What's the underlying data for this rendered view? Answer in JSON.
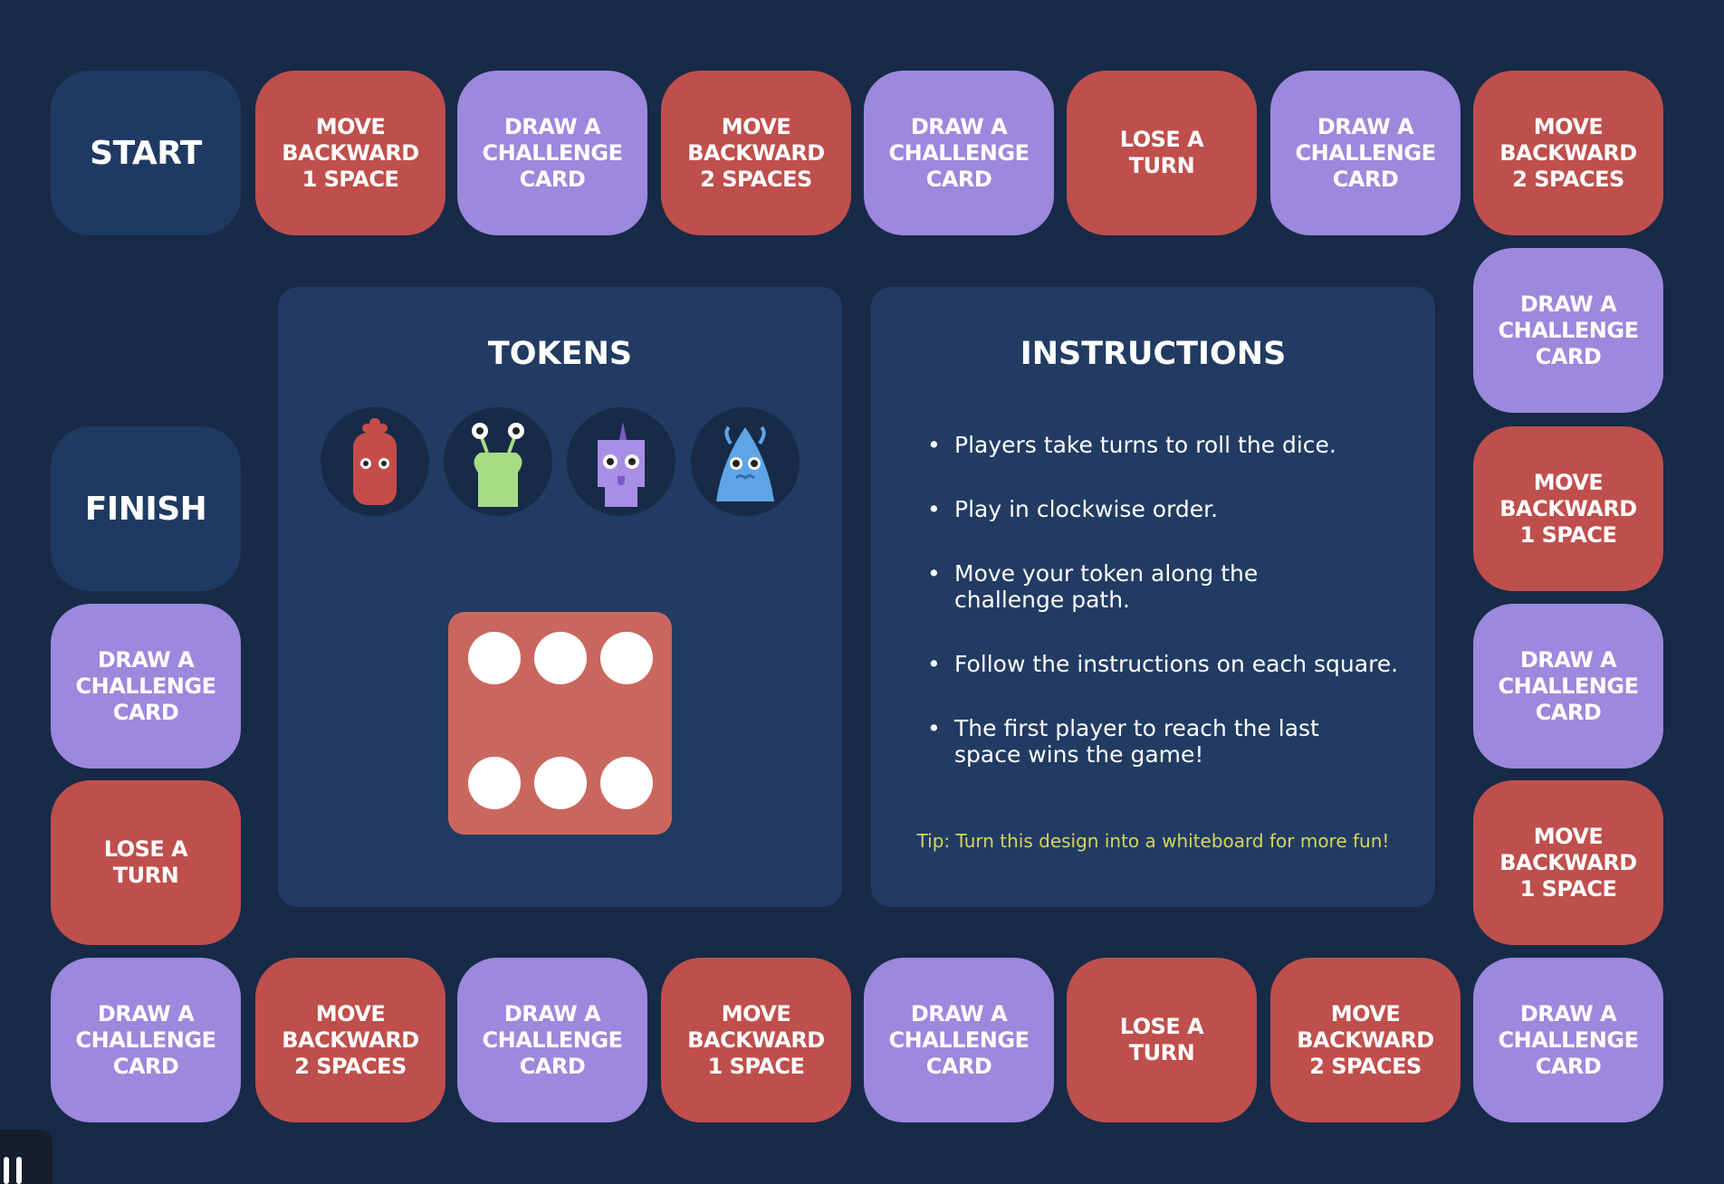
{
  "colors": {
    "background": "#172a47",
    "panel": "#213b63",
    "red": "#bf4f4c",
    "purple": "#9c88dc",
    "navy": "#1f3a62",
    "tip": "#d6d65a"
  },
  "tiles": [
    {
      "label": "START",
      "type": "navy"
    },
    {
      "label": "MOVE\nBACKWARD\n1 SPACE",
      "type": "red"
    },
    {
      "label": "DRAW A\nCHALLENGE\nCARD",
      "type": "purple"
    },
    {
      "label": "MOVE\nBACKWARD\n2 SPACES",
      "type": "red"
    },
    {
      "label": "DRAW A\nCHALLENGE\nCARD",
      "type": "purple"
    },
    {
      "label": "LOSE A\nTURN",
      "type": "red"
    },
    {
      "label": "DRAW A\nCHALLENGE\nCARD",
      "type": "purple"
    },
    {
      "label": "MOVE\nBACKWARD\n2 SPACES",
      "type": "red"
    },
    {
      "label": "DRAW A\nCHALLENGE\nCARD",
      "type": "purple"
    },
    {
      "label": "MOVE\nBACKWARD\n1 SPACE",
      "type": "red"
    },
    {
      "label": "DRAW A\nCHALLENGE\nCARD",
      "type": "purple"
    },
    {
      "label": "MOVE\nBACKWARD\n1 SPACE",
      "type": "red"
    },
    {
      "label": "DRAW A\nCHALLENGE\nCARD",
      "type": "purple"
    },
    {
      "label": "MOVE\nBACKWARD\n2 SPACES",
      "type": "red"
    },
    {
      "label": "LOSE A\nTURN",
      "type": "red"
    },
    {
      "label": "DRAW A\nCHALLENGE\nCARD",
      "type": "purple"
    },
    {
      "label": "MOVE\nBACKWARD\n1 SPACE",
      "type": "red"
    },
    {
      "label": "DRAW A\nCHALLENGE\nCARD",
      "type": "purple"
    },
    {
      "label": "MOVE\nBACKWARD\n2 SPACES",
      "type": "red"
    },
    {
      "label": "DRAW A\nCHALLENGE\nCARD",
      "type": "purple"
    },
    {
      "label": "LOSE A\nTURN",
      "type": "red"
    },
    {
      "label": "DRAW A\nCHALLENGE\nCARD",
      "type": "purple"
    },
    {
      "label": "FINISH",
      "type": "navy"
    }
  ],
  "tokens": {
    "title": "TOKENS",
    "items": [
      {
        "name": "red-monster",
        "color": "#c44d47"
      },
      {
        "name": "green-monster",
        "color": "#a6dc86"
      },
      {
        "name": "purple-monster",
        "color": "#a98ee6"
      },
      {
        "name": "blue-monster",
        "color": "#5da5e6"
      }
    ]
  },
  "dice": {
    "value": 6
  },
  "instructions": {
    "title": "INSTRUCTIONS",
    "items": [
      "Players take turns to roll the dice.",
      "Play in clockwise order.",
      "Move your token along the challenge path.",
      "Follow the instructions on each square.",
      "The first player to reach the last space wins the game!"
    ],
    "tip": "Tip: Turn this design into a whiteboard for more fun!"
  }
}
